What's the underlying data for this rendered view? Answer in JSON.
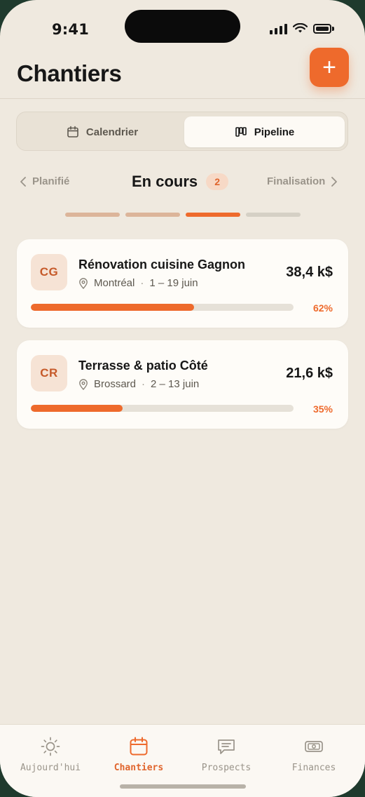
{
  "status": {
    "time": "9:41"
  },
  "header": {
    "title": "Chantiers",
    "add_label": "+"
  },
  "view_toggle": {
    "calendar": "Calendrier",
    "pipeline": "Pipeline",
    "selected": "Pipeline"
  },
  "stage_nav": {
    "prev": "Planifié",
    "current": "En cours",
    "count": "2",
    "next": "Finalisation",
    "dots_active": 3
  },
  "projects": [
    {
      "initials": "CG",
      "title": "Rénovation cuisine Gagnon",
      "city": "Montréal",
      "dates": "1 – 19 juin",
      "amount": "38,4 k$",
      "progress_label": "62%",
      "progress": 0.62
    },
    {
      "initials": "CR",
      "title": "Terrasse & patio Côté",
      "city": "Brossard",
      "dates": "2 – 13 juin",
      "amount": "21,6 k$",
      "progress_label": "35%",
      "progress": 0.35
    }
  ],
  "tabs": [
    {
      "label": "Aujourd'hui",
      "icon": "sun-icon"
    },
    {
      "label": "Chantiers",
      "icon": "calendar-icon",
      "active": true
    },
    {
      "label": "Prospects",
      "icon": "message-icon"
    },
    {
      "label": "Finances",
      "icon": "money-icon"
    }
  ],
  "colors": {
    "accent": "#ee6a2c",
    "background": "#efe9df",
    "card": "#fefcf8"
  }
}
